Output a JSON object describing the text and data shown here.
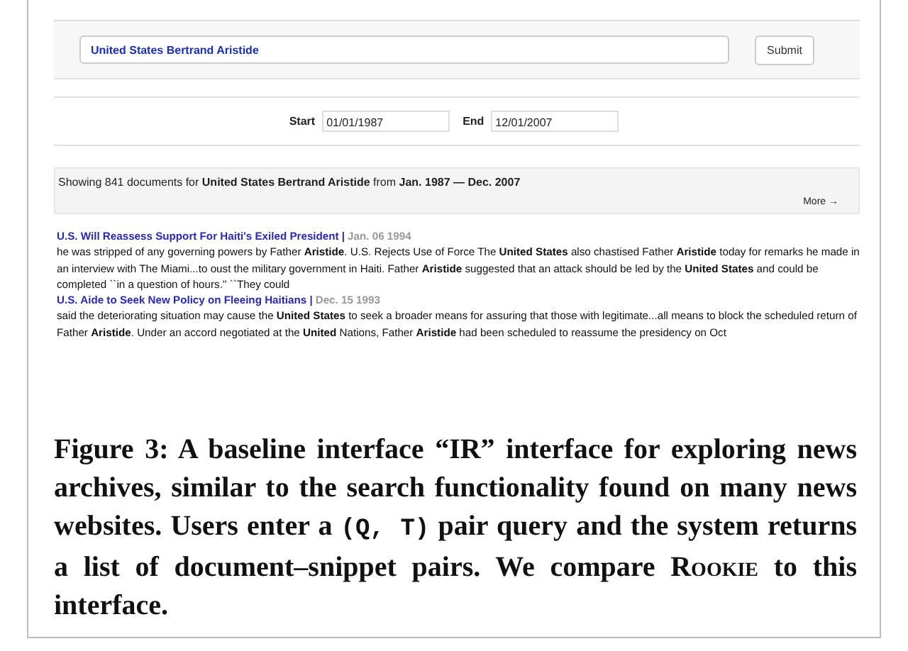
{
  "search": {
    "value": "United States Bertrand Aristide",
    "button": "Submit"
  },
  "date_filter": {
    "start_label": "Start",
    "start_value": "01/01/1987",
    "end_label": "End",
    "end_value": "12/01/2007"
  },
  "results_header": {
    "summary": "Showing 841 documents for **United States Bertrand Aristide** from **Jan. 1987 — Dec. 2007**",
    "more_link": "More →"
  },
  "results": [
    {
      "title": "U.S. Will Reassess Support For Haiti's Exiled President |",
      "date": "Jan. 06 1994",
      "snippet": "he was stripped of any governing powers by Father **Aristide**. U.S. Rejects Use of Force The **United States** also chastised Father **Aristide** today for remarks he made in an interview with The Miami...to oust the military government in Haiti. Father **Aristide** suggested that an attack should be led by the **United States** and could be completed ``in a question of hours.'' ``They could"
    },
    {
      "title": "U.S. Aide to Seek New Policy on Fleeing Haitians |",
      "date": "Dec. 15 1993",
      "snippet": "said the deteriorating situation may cause the **United States** to seek a broader means for assuring that those with legitimate...all means to block the scheduled return of Father **Aristide**. Under an accord negotiated at the **United** Nations, Father **Aristide** had been scheduled to reassume the presidency on Oct"
    }
  ],
  "caption": {
    "label": "Figure 3:",
    "text": "A baseline interface “IR” interface for exploring news archives, similar to the search functionality found on many news websites. Users enter a",
    "notation": "(Q, T)",
    "text_2": "pair query and the system returns a list of document–snippet pairs. We compare",
    "system_name": "Rookie",
    "text_3": "to this interface."
  }
}
